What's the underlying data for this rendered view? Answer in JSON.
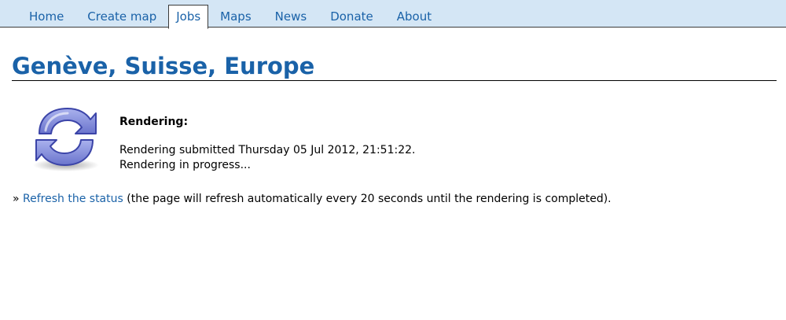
{
  "nav": {
    "items": [
      {
        "label": "Home",
        "active": false
      },
      {
        "label": "Create map",
        "active": false
      },
      {
        "label": "Jobs",
        "active": true
      },
      {
        "label": "Maps",
        "active": false
      },
      {
        "label": "News",
        "active": false
      },
      {
        "label": "Donate",
        "active": false
      },
      {
        "label": "About",
        "active": false
      }
    ]
  },
  "page": {
    "title": "Genève, Suisse, Europe"
  },
  "status": {
    "icon": "refresh-icon",
    "heading": "Rendering:",
    "submitted": "Rendering submitted Thursday 05 Jul 2012, 21:51:22.",
    "progress": "Rendering in progress..."
  },
  "refresh": {
    "prefix": "»",
    "link_label": "Refresh the status",
    "note": "(the page will refresh automatically every 20 seconds until the rendering is completed)."
  },
  "colors": {
    "nav_background": "#d4e6f5",
    "link": "#1a62a8",
    "icon_fill": "#7d88d8",
    "icon_stroke": "#3b44a8"
  }
}
